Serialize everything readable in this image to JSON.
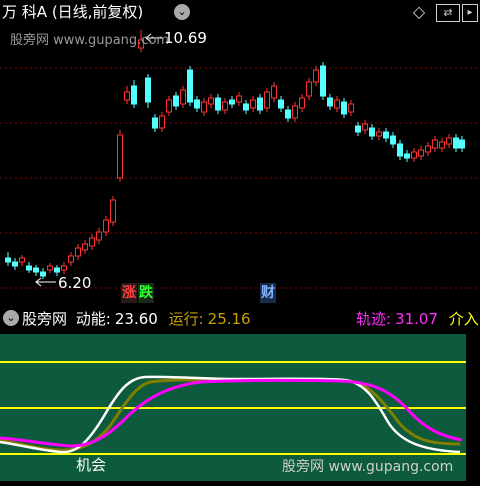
{
  "top": {
    "stock_name": "万 科A",
    "period": "(日线,前复权)",
    "high_label": "10.69",
    "low_label": "6.20",
    "watermark": "股旁网 www.gupang.com",
    "badge_up": "涨",
    "badge_down": "跌",
    "badge_fin": "财",
    "colors": {
      "up": "#ff3232",
      "down": "#54ffff",
      "grid": "#8b0000"
    }
  },
  "indicator": {
    "name": "股旁网",
    "momentum_label": "动能:",
    "momentum_value": "23.60",
    "running_label": "运行:",
    "running_value": "25.16",
    "track_label": "轨迹:",
    "track_value": "31.07",
    "enter_label": "介入",
    "signal_label": "机会",
    "watermark": "股旁网 www.gupang.com",
    "colors": {
      "bg": "#0d5a3c",
      "momentum": "#ffffff",
      "running": "#808000",
      "track": "#ff00ff",
      "level": "#ffff00"
    }
  }
}
